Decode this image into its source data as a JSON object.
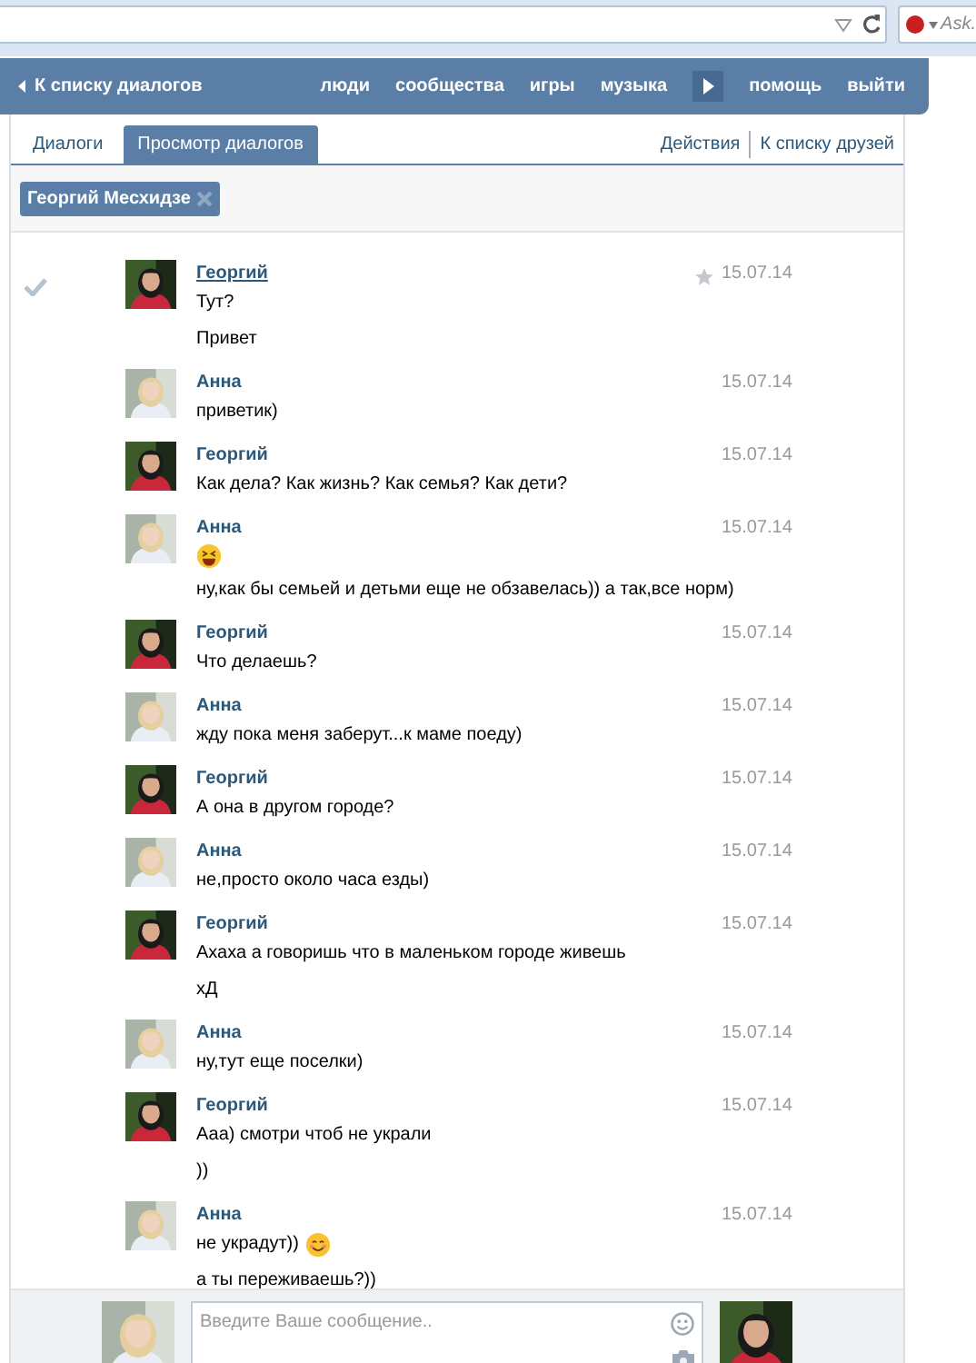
{
  "browser": {
    "search_placeholder": "Ask."
  },
  "header": {
    "back": "К списку диалогов",
    "nav": [
      {
        "kind": "link",
        "label": "люди"
      },
      {
        "kind": "link",
        "label": "сообщества"
      },
      {
        "kind": "link",
        "label": "игры"
      },
      {
        "kind": "link",
        "label": "музыка"
      },
      {
        "kind": "play"
      },
      {
        "kind": "link",
        "label": "помощь"
      },
      {
        "kind": "link",
        "label": "выйти"
      }
    ]
  },
  "tabs": [
    {
      "label": "Диалоги",
      "selected": false
    },
    {
      "label": "Просмотр диалогов",
      "selected": true
    }
  ],
  "actions": [
    "Действия",
    "К списку друзей"
  ],
  "recipient": "Георгий Месхидзе",
  "messages": [
    {
      "author": "Георгий",
      "outgoing": false,
      "date": "15.07.14",
      "hovered": true,
      "lines": [
        {
          "text": "Тут?"
        },
        {
          "text": "Привет"
        }
      ]
    },
    {
      "author": "Анна",
      "outgoing": true,
      "date": "15.07.14",
      "hovered": false,
      "lines": [
        {
          "text": "приветик)"
        }
      ]
    },
    {
      "author": "Георгий",
      "outgoing": false,
      "date": "15.07.14",
      "hovered": false,
      "lines": [
        {
          "text": "Как дела? Как жизнь? Как семья? Как дети?"
        }
      ]
    },
    {
      "author": "Анна",
      "outgoing": true,
      "date": "15.07.14",
      "hovered": false,
      "lines": [
        {
          "icon": {
            "kind": "laughing"
          }
        },
        {
          "text": "ну,как бы семьей и детьми еще не обзавелась)) а так,все норм)"
        }
      ]
    },
    {
      "author": "Георгий",
      "outgoing": false,
      "date": "15.07.14",
      "hovered": false,
      "lines": [
        {
          "text": "Что делаешь?"
        }
      ]
    },
    {
      "author": "Анна",
      "outgoing": true,
      "date": "15.07.14",
      "hovered": false,
      "lines": [
        {
          "text": "жду пока меня заберут...к маме поеду)"
        }
      ]
    },
    {
      "author": "Георгий",
      "outgoing": false,
      "date": "15.07.14",
      "hovered": false,
      "lines": [
        {
          "text": "А она в другом городе?"
        }
      ]
    },
    {
      "author": "Анна",
      "outgoing": true,
      "date": "15.07.14",
      "hovered": false,
      "lines": [
        {
          "text": "не,просто около часа езды)"
        }
      ]
    },
    {
      "author": "Георгий",
      "outgoing": false,
      "date": "15.07.14",
      "hovered": false,
      "lines": [
        {
          "text": "Ахаха а говоришь что в маленьком городе живешь"
        },
        {
          "text": "хД"
        }
      ]
    },
    {
      "author": "Анна",
      "outgoing": true,
      "date": "15.07.14",
      "hovered": false,
      "lines": [
        {
          "text": "ну,тут еще поселки)"
        }
      ]
    },
    {
      "author": "Георгий",
      "outgoing": false,
      "date": "15.07.14",
      "hovered": false,
      "lines": [
        {
          "text": "Ааа) смотри чтоб не украли"
        },
        {
          "text": "))"
        }
      ]
    },
    {
      "author": "Анна",
      "outgoing": true,
      "date": "15.07.14",
      "hovered": false,
      "lines": [
        {
          "text": "не украдут))",
          "icon": {
            "kind": "smiling"
          }
        },
        {
          "text": "а ты переживаешь?))"
        }
      ]
    }
  ],
  "compose": {
    "placeholder": "Введите Ваше сообщение.."
  }
}
